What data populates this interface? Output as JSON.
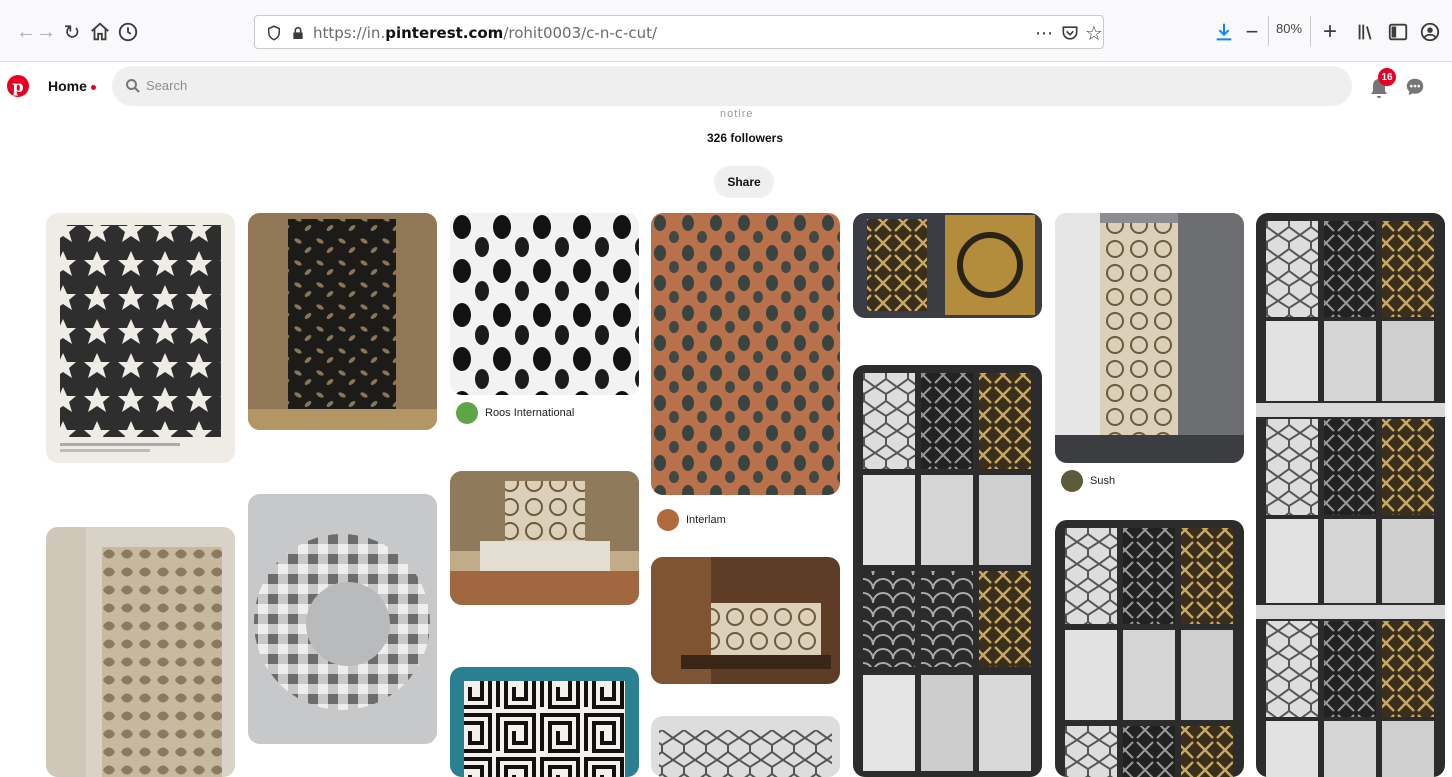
{
  "browser": {
    "url_prefix": "https://in.",
    "url_domain": "pinterest.com",
    "url_path": "/rohit0003/c-n-c-cut/",
    "more_label": "⋯",
    "zoom": "80%"
  },
  "header": {
    "logo": "p",
    "home_label": "Home",
    "search_placeholder": "Search",
    "notifications": "16"
  },
  "board": {
    "name_partial": "notire",
    "followers": "326 followers",
    "share_label": "Share"
  },
  "attributions": {
    "roos": "Roos International",
    "interlam": "Interlam",
    "sush": "Sush"
  },
  "colors": {
    "accent": "#e60023",
    "download": "#0a84ff"
  }
}
